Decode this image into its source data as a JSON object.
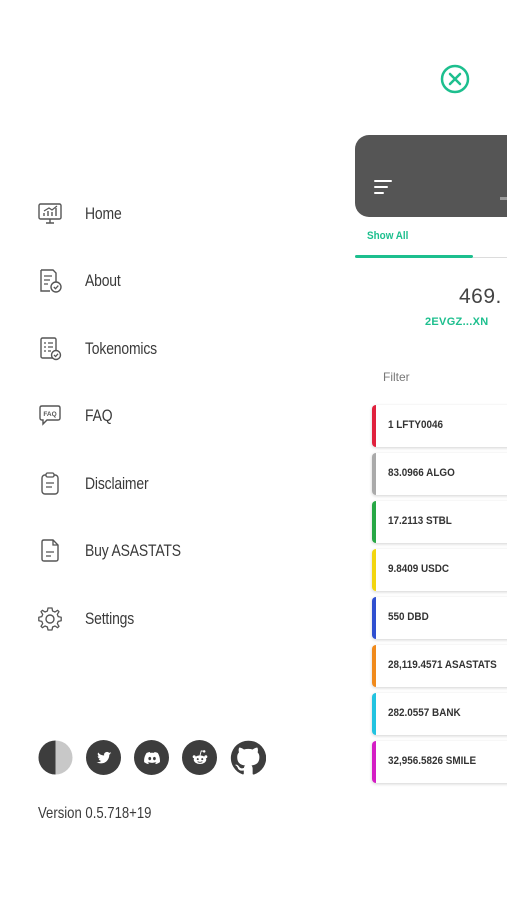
{
  "close": {
    "icon": "close-circle-icon",
    "color": "#1dbf8e"
  },
  "menu": [
    {
      "label": "Home",
      "icon": "chart-monitor-icon"
    },
    {
      "label": "About",
      "icon": "document-check-icon"
    },
    {
      "label": "Tokenomics",
      "icon": "document-list-icon"
    },
    {
      "label": "FAQ",
      "icon": "faq-bubble-icon"
    },
    {
      "label": "Disclaimer",
      "icon": "clipboard-icon"
    },
    {
      "label": "Buy ASASTATS",
      "icon": "file-icon"
    },
    {
      "label": "Settings",
      "icon": "gear-icon"
    }
  ],
  "socials": [
    "theme-toggle-icon",
    "twitter-icon",
    "discord-icon",
    "reddit-icon",
    "github-icon"
  ],
  "version": "Version 0.5.718+19",
  "main": {
    "tab_label": "Show All",
    "balance": "469.",
    "address": "2EVGZ...XN",
    "filter_placeholder": "Filter",
    "accent": "#1dbf8e",
    "assets": [
      {
        "label": "1 LFTY0046",
        "color": "#e0213d"
      },
      {
        "label": "83.0966 ALGO",
        "color": "#aaaaaa"
      },
      {
        "label": "17.2113 STBL",
        "color": "#27a745"
      },
      {
        "label": "9.8409 USDC",
        "color": "#f2d50f"
      },
      {
        "label": "550 DBD",
        "color": "#2f4fd0"
      },
      {
        "label": "28,119.4571 ASASTATS",
        "color": "#f08a1c"
      },
      {
        "label": "282.0557 BANK",
        "color": "#22c3e0"
      },
      {
        "label": "32,956.5826 SMILE",
        "color": "#d41ec4"
      }
    ]
  }
}
